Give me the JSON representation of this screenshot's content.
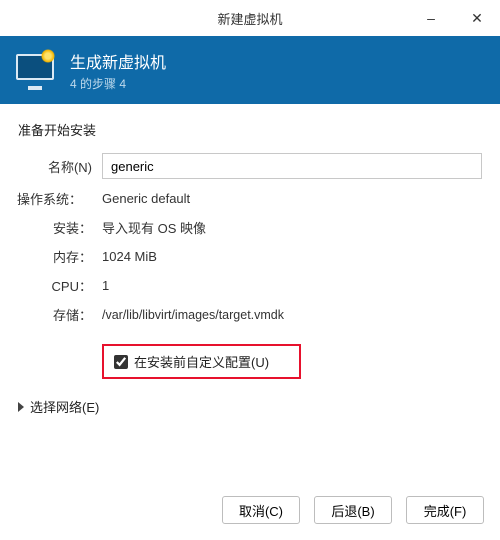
{
  "window": {
    "title": "新建虚拟机"
  },
  "banner": {
    "heading": "生成新虚拟机",
    "step": "4 的步骤 4"
  },
  "content": {
    "ready_label": "准备开始安装",
    "rows": {
      "name_label": "名称(N)",
      "name_value": "generic",
      "os_label": "操作系统：",
      "os_value": "Generic default",
      "install_label": "安装：",
      "install_value": "导入现有 OS 映像",
      "memory_label": "内存：",
      "memory_value": "1024 MiB",
      "cpu_label": "CPU：",
      "cpu_value": "1",
      "storage_label": "存储：",
      "storage_value": "/var/lib/libvirt/images/target.vmdk"
    },
    "customize_label": "在安装前自定义配置(U)",
    "network_label": "选择网络(E)"
  },
  "footer": {
    "cancel": "取消(C)",
    "back": "后退(B)",
    "finish": "完成(F)"
  }
}
